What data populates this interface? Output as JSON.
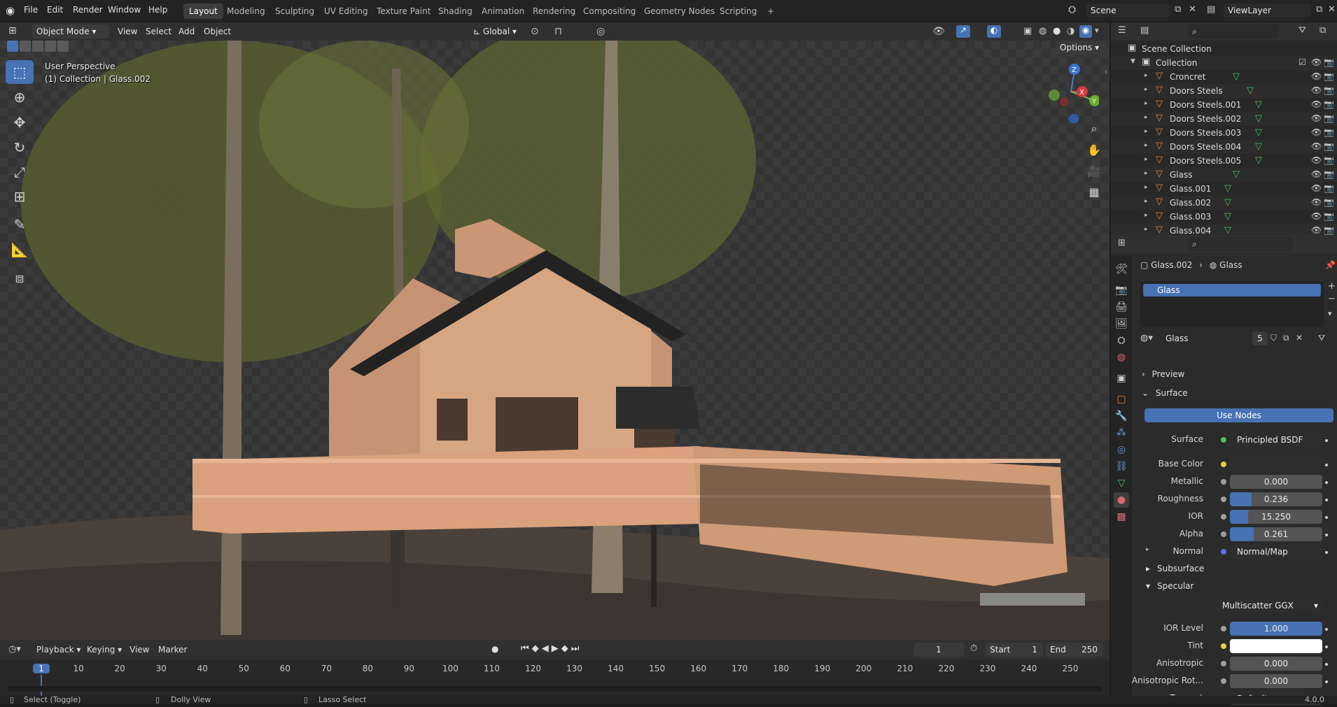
{
  "topbar": {
    "menus": [
      "File",
      "Edit",
      "Render",
      "Window",
      "Help"
    ],
    "workspaces": [
      "Layout",
      "Modeling",
      "Sculpting",
      "UV Editing",
      "Texture Paint",
      "Shading",
      "Animation",
      "Rendering",
      "Compositing",
      "Geometry Nodes",
      "Scripting"
    ],
    "active_workspace": "Layout",
    "add_tab": "+",
    "scene_name": "Scene",
    "view_layer": "ViewLayer"
  },
  "viewport_header": {
    "mode": "Object Mode",
    "menus": [
      "View",
      "Select",
      "Add",
      "Object"
    ],
    "transform_orientation": "Global",
    "options_label": "Options"
  },
  "viewport": {
    "view_name": "User Perspective",
    "context": "(1) Collection | Glass.002",
    "gizmo_axes": [
      "Z",
      "X",
      "Y"
    ]
  },
  "outliner": {
    "root": "Scene Collection",
    "collection": "Collection",
    "objects": [
      {
        "name": "Croncret"
      },
      {
        "name": "Doors Steels"
      },
      {
        "name": "Doors Steels.001"
      },
      {
        "name": "Doors Steels.002"
      },
      {
        "name": "Doors Steels.003"
      },
      {
        "name": "Doors Steels.004"
      },
      {
        "name": "Doors Steels.005"
      },
      {
        "name": "Glass"
      },
      {
        "name": "Glass.001"
      },
      {
        "name": "Glass.002"
      },
      {
        "name": "Glass.003"
      },
      {
        "name": "Glass.004"
      }
    ]
  },
  "properties": {
    "breadcrumb_object": "Glass.002",
    "breadcrumb_material": "Glass",
    "slot_name": "Glass",
    "material_name": "Glass",
    "user_count": "5",
    "preview_label": "Preview",
    "surface_label": "Surface",
    "use_nodes": "Use Nodes",
    "surface_row": {
      "label": "Surface",
      "value": "Principled BSDF"
    },
    "base_color": {
      "label": "Base Color"
    },
    "metallic": {
      "label": "Metallic",
      "value": "0.000",
      "fraction": 0
    },
    "roughness": {
      "label": "Roughness",
      "value": "0.236",
      "fraction": 0.236
    },
    "ior": {
      "label": "IOR",
      "value": "15.250",
      "fraction": 0.2
    },
    "alpha": {
      "label": "Alpha",
      "value": "0.261",
      "fraction": 0.261
    },
    "normal": {
      "label": "Normal",
      "value": "Normal/Map"
    },
    "subsurface": "Subsurface",
    "specular": "Specular",
    "distribution": "Multiscatter GGX",
    "ior_level": {
      "label": "IOR Level",
      "value": "1.000",
      "fraction": 1
    },
    "tint": {
      "label": "Tint",
      "color": "#ffffff"
    },
    "anisotropic": {
      "label": "Anisotropic",
      "value": "0.000",
      "fraction": 0
    },
    "anisotropic_rot": {
      "label": "Anisotropic Rot...",
      "value": "0.000",
      "fraction": 0
    },
    "tangent": {
      "label": "Tangent",
      "value": "Default"
    }
  },
  "timeline": {
    "menus": [
      "Playback",
      "Keying",
      "View",
      "Marker"
    ],
    "current_frame": "1",
    "start_label": "Start",
    "start": "1",
    "end_label": "End",
    "end": "250",
    "ticks": [
      "1",
      "10",
      "20",
      "30",
      "40",
      "50",
      "60",
      "70",
      "80",
      "90",
      "100",
      "110",
      "120",
      "130",
      "140",
      "150",
      "160",
      "170",
      "180",
      "190",
      "200",
      "210",
      "220",
      "230",
      "240",
      "250"
    ]
  },
  "statusbar": {
    "items": [
      "Select (Toggle)",
      "Dolly View",
      "Lasso Select"
    ],
    "version": "4.0.0"
  },
  "colors": {
    "accent": "#4772b3",
    "object_icon": "#e4843c",
    "mesh_icon": "#4fbf62"
  }
}
